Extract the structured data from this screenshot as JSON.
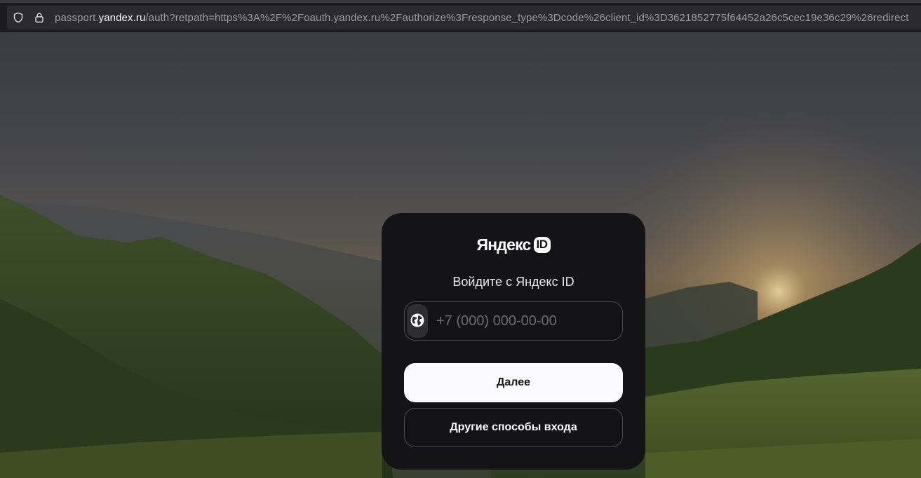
{
  "browser": {
    "url_prefix": "passport.",
    "url_domain": "yandex.ru",
    "url_rest": "/auth?retpath=https%3A%2F%2Foauth.yandex.ru%2Fauthorize%3Fresponse_type%3Dcode%26client_id%3D3621852775f64452a26c5cec19e36c29%26redirect"
  },
  "login": {
    "logo_word": "Яндекс",
    "logo_badge": "ID",
    "heading": "Войдите с Яндекс ID",
    "phone_placeholder": "+7 (000) 000-00-00",
    "country_icon": "globe-icon",
    "next_label": "Далее",
    "other_methods_label": "Другие способы входа"
  },
  "colors": {
    "card_bg": "#141417",
    "primary_button": "#fbfbfe",
    "browser_bg": "#1c1b22"
  }
}
